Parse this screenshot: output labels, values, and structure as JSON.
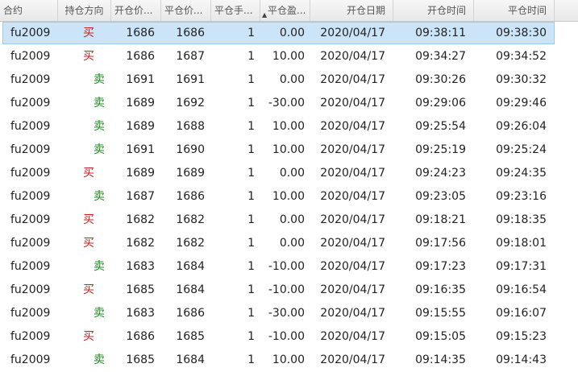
{
  "table": {
    "columns": [
      "合约",
      "持仓方向",
      "开仓价...",
      "平仓价...",
      "平仓手...",
      "平仓盈...",
      "开仓日期",
      "开仓时间",
      "平仓时间"
    ],
    "sorted_column": "平仓盈...",
    "direction_colors": {
      "买": "#c8201f",
      "卖": "#1e8a1e"
    },
    "selected_row": 0,
    "rows": [
      [
        "fu2009",
        "买",
        "1686",
        "1686",
        "1",
        "0.00",
        "2020/04/17",
        "09:38:11",
        "09:38:30"
      ],
      [
        "fu2009",
        "买",
        "1686",
        "1687",
        "1",
        "10.00",
        "2020/04/17",
        "09:34:27",
        "09:34:52"
      ],
      [
        "fu2009",
        "卖",
        "1691",
        "1691",
        "1",
        "0.00",
        "2020/04/17",
        "09:30:26",
        "09:30:32"
      ],
      [
        "fu2009",
        "卖",
        "1689",
        "1692",
        "1",
        "-30.00",
        "2020/04/17",
        "09:29:06",
        "09:29:46"
      ],
      [
        "fu2009",
        "卖",
        "1689",
        "1688",
        "1",
        "10.00",
        "2020/04/17",
        "09:25:54",
        "09:26:04"
      ],
      [
        "fu2009",
        "卖",
        "1691",
        "1690",
        "1",
        "10.00",
        "2020/04/17",
        "09:25:19",
        "09:25:24"
      ],
      [
        "fu2009",
        "买",
        "1689",
        "1689",
        "1",
        "0.00",
        "2020/04/17",
        "09:24:23",
        "09:24:35"
      ],
      [
        "fu2009",
        "卖",
        "1687",
        "1686",
        "1",
        "10.00",
        "2020/04/17",
        "09:23:05",
        "09:23:16"
      ],
      [
        "fu2009",
        "买",
        "1682",
        "1682",
        "1",
        "0.00",
        "2020/04/17",
        "09:18:21",
        "09:18:35"
      ],
      [
        "fu2009",
        "买",
        "1682",
        "1682",
        "1",
        "0.00",
        "2020/04/17",
        "09:17:56",
        "09:18:01"
      ],
      [
        "fu2009",
        "卖",
        "1683",
        "1684",
        "1",
        "-10.00",
        "2020/04/17",
        "09:17:23",
        "09:17:31"
      ],
      [
        "fu2009",
        "买",
        "1685",
        "1684",
        "1",
        "-10.00",
        "2020/04/17",
        "09:16:35",
        "09:16:54"
      ],
      [
        "fu2009",
        "卖",
        "1683",
        "1686",
        "1",
        "-30.00",
        "2020/04/17",
        "09:15:55",
        "09:16:07"
      ],
      [
        "fu2009",
        "买",
        "1686",
        "1685",
        "1",
        "-10.00",
        "2020/04/17",
        "09:15:05",
        "09:15:23"
      ],
      [
        "fu2009",
        "卖",
        "1685",
        "1684",
        "1",
        "10.00",
        "2020/04/17",
        "09:14:35",
        "09:14:43"
      ]
    ]
  }
}
